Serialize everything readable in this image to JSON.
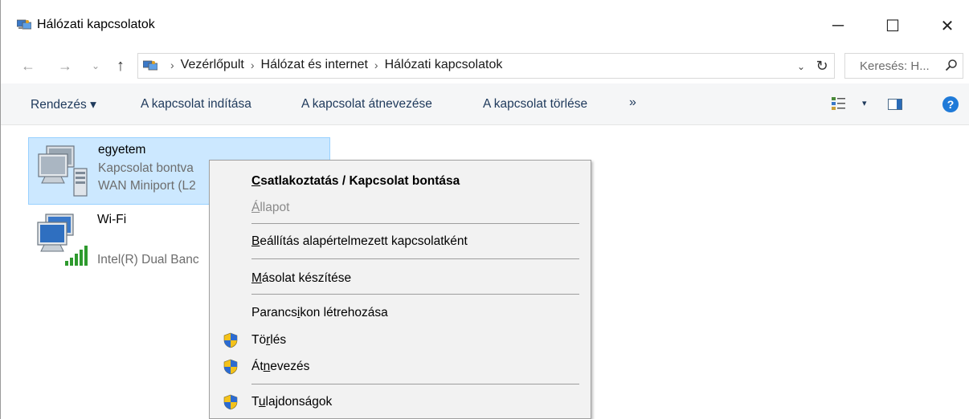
{
  "window": {
    "title": "Hálózati kapcsolatok",
    "app_icon": "network-connections-icon",
    "controls": {
      "minimize": "─",
      "maximize": "☐",
      "close": "✕"
    }
  },
  "navigation": {
    "back": "←",
    "forward": "→",
    "recent": "⌄",
    "up": "↑",
    "breadcrumbs": [
      "Vezérlőpult",
      "Hálózat és internet",
      "Hálózati kapcsolatok"
    ],
    "breadcrumb_separator": "›",
    "dropdown": "⌄",
    "refresh": "↻",
    "search_placeholder": "Keresés: H...",
    "search_icon": "⚲"
  },
  "commandbar": {
    "organize": "Rendezés ▾",
    "start_connection": "A kapcsolat indítása",
    "rename_connection": "A kapcsolat átnevezése",
    "delete_connection": "A kapcsolat törlése",
    "more": "»",
    "view_dropdown": "▾",
    "help": "?"
  },
  "connections": [
    {
      "name": "egyetem",
      "status": "Kapcsolat bontva",
      "device": "WAN Miniport (L2",
      "selected": true
    },
    {
      "name": "Wi-Fi",
      "status": "",
      "device": "Intel(R) Dual Banc",
      "selected": false
    }
  ],
  "context_menu": {
    "items": [
      {
        "pre": "",
        "ul": "C",
        "post": "satlakoztatás / Kapcsolat bontása",
        "bold": true,
        "disabled": false,
        "shield": false
      },
      {
        "pre": "",
        "ul": "Á",
        "post": "llapot",
        "bold": false,
        "disabled": true,
        "shield": false
      },
      {
        "pre": "",
        "ul": "B",
        "post": "eállítás alapértelmezett kapcsolatként",
        "bold": false,
        "disabled": false,
        "shield": false
      },
      {
        "pre": "",
        "ul": "M",
        "post": "ásolat készítése",
        "bold": false,
        "disabled": false,
        "shield": false
      },
      {
        "pre": "Parancs",
        "ul": "i",
        "post": "kon létrehozása",
        "bold": false,
        "disabled": false,
        "shield": false
      },
      {
        "pre": "Tö",
        "ul": "r",
        "post": "lés",
        "bold": false,
        "disabled": false,
        "shield": true
      },
      {
        "pre": "Át",
        "ul": "n",
        "post": "evezés",
        "bold": false,
        "disabled": false,
        "shield": true
      },
      {
        "pre": "T",
        "ul": "u",
        "post": "lajdonságok",
        "bold": false,
        "disabled": false,
        "shield": true
      }
    ]
  },
  "colors": {
    "selection_bg": "#cce8ff",
    "selection_border": "#99d1ff",
    "command_text": "#1e395b",
    "menu_bg": "#f2f2f2",
    "secondary_text": "#6d6d6d"
  }
}
